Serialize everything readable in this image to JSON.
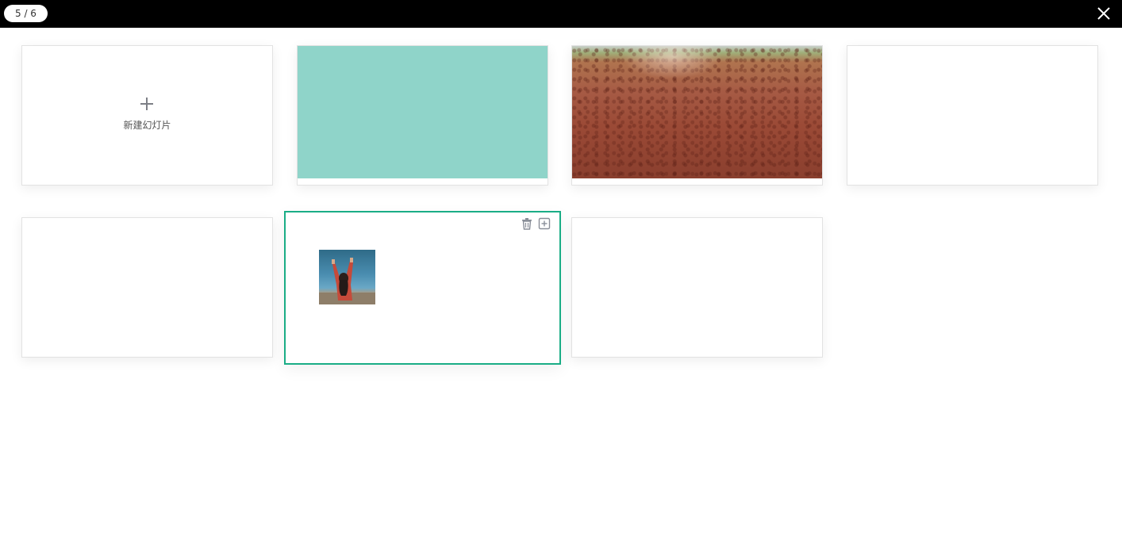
{
  "header": {
    "counter": "5 / 6",
    "close_icon": "close-icon"
  },
  "slides": {
    "new_slide": {
      "label": "新建幻灯片",
      "icon": "plus-icon"
    },
    "teal_slide": {
      "fill_color": "#8fd4c9"
    },
    "active_slide": {
      "border_color": "#1aad86",
      "actions": {
        "delete_icon": "trash-icon",
        "add_icon": "add-slide-icon"
      }
    }
  },
  "colors": {
    "topbar": "#000000",
    "accent": "#1aad86"
  }
}
